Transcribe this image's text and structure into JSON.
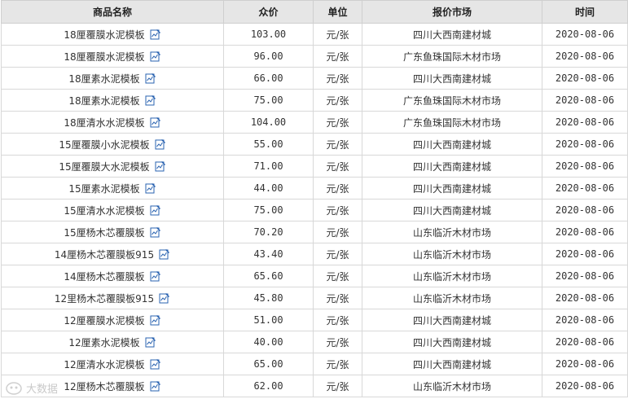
{
  "headers": {
    "name": "商品名称",
    "price": "众价",
    "unit": "单位",
    "market": "报价市场",
    "time": "时间"
  },
  "rows": [
    {
      "name": "18厘覆膜水泥模板",
      "price": "103.00",
      "unit": "元/张",
      "market": "四川大西南建材城",
      "time": "2020-08-06"
    },
    {
      "name": "18厘覆膜水泥模板",
      "price": "96.00",
      "unit": "元/张",
      "market": "广东鱼珠国际木材市场",
      "time": "2020-08-06"
    },
    {
      "name": "18厘素水泥模板",
      "price": "66.00",
      "unit": "元/张",
      "market": "四川大西南建材城",
      "time": "2020-08-06"
    },
    {
      "name": "18厘素水泥模板",
      "price": "75.00",
      "unit": "元/张",
      "market": "广东鱼珠国际木材市场",
      "time": "2020-08-06"
    },
    {
      "name": "18厘清水水泥模板",
      "price": "104.00",
      "unit": "元/张",
      "market": "广东鱼珠国际木材市场",
      "time": "2020-08-06"
    },
    {
      "name": "15厘覆膜小水泥模板",
      "price": "55.00",
      "unit": "元/张",
      "market": "四川大西南建材城",
      "time": "2020-08-06"
    },
    {
      "name": "15厘覆膜大水泥模板",
      "price": "71.00",
      "unit": "元/张",
      "market": "四川大西南建材城",
      "time": "2020-08-06"
    },
    {
      "name": "15厘素水泥模板",
      "price": "44.00",
      "unit": "元/张",
      "market": "四川大西南建材城",
      "time": "2020-08-06"
    },
    {
      "name": "15厘清水水泥模板",
      "price": "75.00",
      "unit": "元/张",
      "market": "四川大西南建材城",
      "time": "2020-08-06"
    },
    {
      "name": "15厘杨木芯覆膜板",
      "price": "70.20",
      "unit": "元/张",
      "market": "山东临沂木材市场",
      "time": "2020-08-06"
    },
    {
      "name": "14厘杨木芯覆膜板915",
      "price": "43.40",
      "unit": "元/张",
      "market": "山东临沂木材市场",
      "time": "2020-08-06"
    },
    {
      "name": "14厘杨木芯覆膜板",
      "price": "65.60",
      "unit": "元/张",
      "market": "山东临沂木材市场",
      "time": "2020-08-06"
    },
    {
      "name": "12里杨木芯覆膜板915",
      "price": "45.80",
      "unit": "元/张",
      "market": "山东临沂木材市场",
      "time": "2020-08-06"
    },
    {
      "name": "12厘覆膜水泥模板",
      "price": "51.00",
      "unit": "元/张",
      "market": "四川大西南建材城",
      "time": "2020-08-06"
    },
    {
      "name": "12厘素水泥模板",
      "price": "40.00",
      "unit": "元/张",
      "market": "四川大西南建材城",
      "time": "2020-08-06"
    },
    {
      "name": "12厘清水水泥模板",
      "price": "65.00",
      "unit": "元/张",
      "market": "四川大西南建材城",
      "time": "2020-08-06"
    },
    {
      "name": "12厘杨木芯覆膜板",
      "price": "62.00",
      "unit": "元/张",
      "market": "山东临沂木材市场",
      "time": "2020-08-06"
    }
  ],
  "icons": {
    "row_action": "chart-edit-icon",
    "watermark": "watermark-logo-icon"
  },
  "watermark": {
    "text": "大数据"
  },
  "colors": {
    "header_bg": "#e6e6e6",
    "border": "#d8d8d8",
    "icon": "#2a63b0"
  }
}
